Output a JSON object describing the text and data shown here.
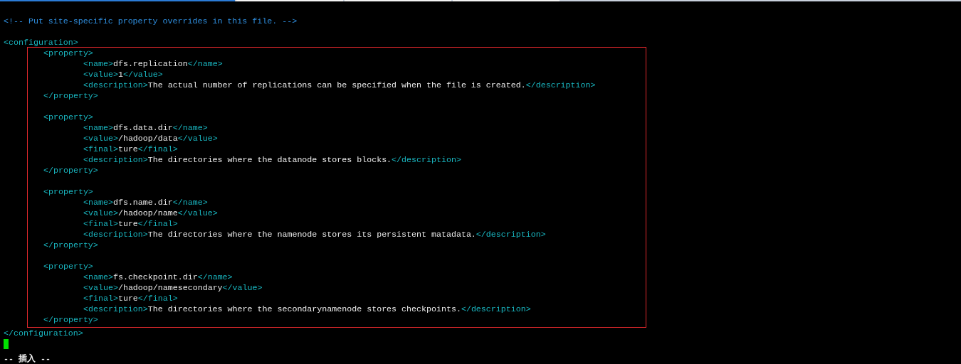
{
  "comment": "<!-- Put site-specific property overrides in this file. -->",
  "root_open": "<configuration>",
  "properties": [
    {
      "open": "<property>",
      "fields": [
        {
          "segments": [
            {
              "kind": "tag",
              "text": "<name>"
            },
            {
              "kind": "text",
              "text": "dfs.replication"
            },
            {
              "kind": "tag",
              "text": "</name>"
            }
          ]
        },
        {
          "segments": [
            {
              "kind": "tag",
              "text": "<value>"
            },
            {
              "kind": "text",
              "text": "1"
            },
            {
              "kind": "tag",
              "text": "</value>"
            }
          ]
        },
        {
          "segments": [
            {
              "kind": "tag",
              "text": "<description>"
            },
            {
              "kind": "text",
              "text": "The actual number of replications can be specified when the file is created."
            },
            {
              "kind": "tag",
              "text": "</description>"
            }
          ]
        }
      ],
      "close": "</property>"
    },
    {
      "open": "<property>",
      "fields": [
        {
          "segments": [
            {
              "kind": "tag",
              "text": "<name>"
            },
            {
              "kind": "text",
              "text": "dfs.data.dir"
            },
            {
              "kind": "tag",
              "text": "</name>"
            }
          ]
        },
        {
          "segments": [
            {
              "kind": "tag",
              "text": "<value>"
            },
            {
              "kind": "text",
              "text": "/hadoop/data"
            },
            {
              "kind": "tag",
              "text": "</value>"
            }
          ]
        },
        {
          "segments": [
            {
              "kind": "tag",
              "text": "<final>"
            },
            {
              "kind": "text",
              "text": "ture"
            },
            {
              "kind": "tag",
              "text": "</final>"
            }
          ]
        },
        {
          "segments": [
            {
              "kind": "tag",
              "text": "<description>"
            },
            {
              "kind": "text",
              "text": "The directories where the datanode stores blocks."
            },
            {
              "kind": "tag",
              "text": "</description>"
            }
          ]
        }
      ],
      "close": "</property>"
    },
    {
      "open": "<property>",
      "fields": [
        {
          "segments": [
            {
              "kind": "tag",
              "text": "<name>"
            },
            {
              "kind": "text",
              "text": "dfs.name.dir"
            },
            {
              "kind": "tag",
              "text": "</name>"
            }
          ]
        },
        {
          "segments": [
            {
              "kind": "tag",
              "text": "<value>"
            },
            {
              "kind": "text",
              "text": "/hadoop/name"
            },
            {
              "kind": "tag",
              "text": "</value>"
            }
          ]
        },
        {
          "segments": [
            {
              "kind": "tag",
              "text": "<final>"
            },
            {
              "kind": "text",
              "text": "ture"
            },
            {
              "kind": "tag",
              "text": "</final>"
            }
          ]
        },
        {
          "segments": [
            {
              "kind": "tag",
              "text": "<description>"
            },
            {
              "kind": "text",
              "text": "The directories where the namenode stores its persistent matadata."
            },
            {
              "kind": "tag",
              "text": "</description>"
            }
          ]
        }
      ],
      "close": "</property>"
    },
    {
      "open": "<property>",
      "fields": [
        {
          "segments": [
            {
              "kind": "tag",
              "text": "<name>"
            },
            {
              "kind": "text",
              "text": "fs.checkpoint.dir"
            },
            {
              "kind": "tag",
              "text": "</name>"
            }
          ]
        },
        {
          "segments": [
            {
              "kind": "tag",
              "text": "<value>"
            },
            {
              "kind": "text",
              "text": "/hadoop/namesecondary"
            },
            {
              "kind": "tag",
              "text": "</value>"
            }
          ]
        },
        {
          "segments": [
            {
              "kind": "tag",
              "text": "<final>"
            },
            {
              "kind": "text",
              "text": "ture"
            },
            {
              "kind": "tag",
              "text": "</final>"
            }
          ]
        },
        {
          "segments": [
            {
              "kind": "tag",
              "text": "<description>"
            },
            {
              "kind": "text",
              "text": "The directories where the secondarynamenode stores checkpoints."
            },
            {
              "kind": "tag",
              "text": "</description>"
            }
          ]
        }
      ],
      "close": "</property>"
    }
  ],
  "root_close": "</configuration>",
  "status_line": "-- 插入 --"
}
